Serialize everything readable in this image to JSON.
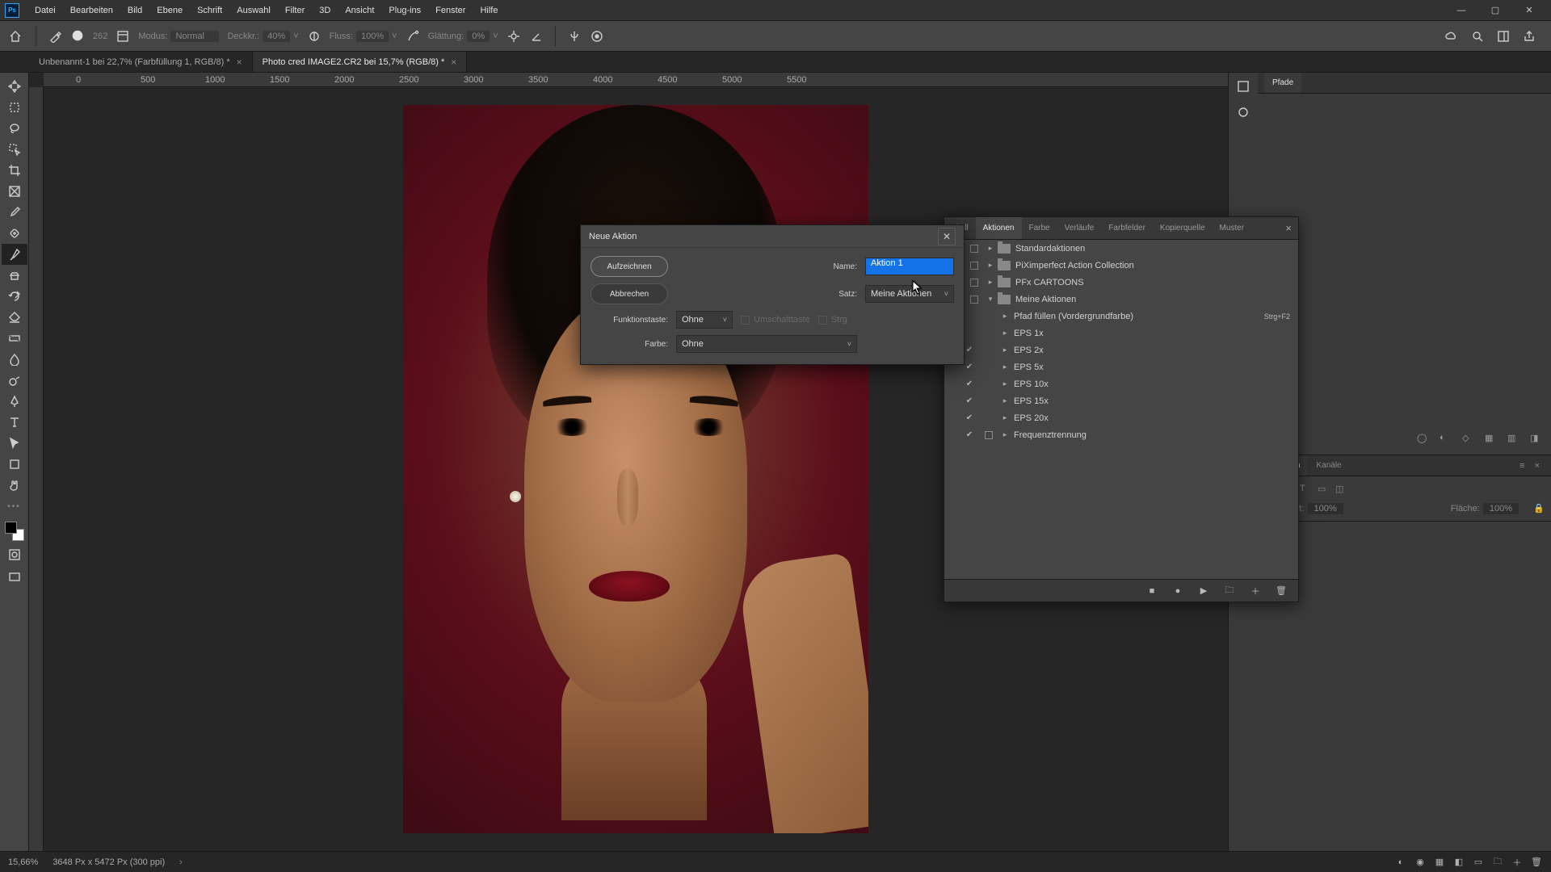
{
  "menubar": {
    "items": [
      "Datei",
      "Bearbeiten",
      "Bild",
      "Ebene",
      "Schrift",
      "Auswahl",
      "Filter",
      "3D",
      "Ansicht",
      "Plug-ins",
      "Fenster",
      "Hilfe"
    ]
  },
  "optbar": {
    "brush_size": "262",
    "mode_label": "Modus:",
    "mode_value": "Normal",
    "opacity_label": "Deckkr.:",
    "opacity_value": "40%",
    "flow_label": "Fluss:",
    "flow_value": "100%",
    "smoothing_label": "Glättung:",
    "smoothing_value": "0%"
  },
  "tabs": [
    {
      "label": "Unbenannt-1 bei 22,7% (Farbfüllung 1, RGB/8) *"
    },
    {
      "label": "Photo cred IMAGE2.CR2 bei 15,7% (RGB/8) *"
    }
  ],
  "ruler_marks": [
    "0",
    "500",
    "1000",
    "1500",
    "2000",
    "2500",
    "3000",
    "3500",
    "4000",
    "4500",
    "5000",
    "5500"
  ],
  "dialog": {
    "title": "Neue Aktion",
    "name_label": "Name:",
    "name_value": "Aktion 1",
    "set_label": "Satz:",
    "set_value": "Meine Aktionen",
    "fkey_label": "Funktionstaste:",
    "fkey_value": "Ohne",
    "shift_label": "Umschalttaste",
    "ctrl_label": "Strg",
    "color_label": "Farbe:",
    "color_value": "Ohne",
    "record_btn": "Aufzeichnen",
    "cancel_btn": "Abbrechen"
  },
  "actions_panel": {
    "tabs": [
      "okoll",
      "Aktionen",
      "Farbe",
      "Verläufe",
      "Farbfelder",
      "Kopierquelle",
      "Muster"
    ],
    "active": 1,
    "sets": [
      {
        "name": "Standardaktionen",
        "check": true,
        "dlg": true,
        "expanded": false
      },
      {
        "name": "PiXimperfect Action Collection",
        "check": true,
        "dlg": true,
        "expanded": false
      },
      {
        "name": "PFx CARTOONS",
        "check": true,
        "dlg": true,
        "expanded": false
      },
      {
        "name": "Meine Aktionen",
        "check": true,
        "dlg": true,
        "expanded": true,
        "children": [
          {
            "name": "Pfad füllen (Vordergrundfarbe)",
            "shortcut": "Strg+F2",
            "check": false,
            "dlg": false
          },
          {
            "name": "EPS 1x",
            "check": false,
            "dlg": false
          },
          {
            "name": "EPS 2x",
            "check": true,
            "dlg": false
          },
          {
            "name": "EPS 5x",
            "check": true,
            "dlg": false
          },
          {
            "name": "EPS 10x",
            "check": true,
            "dlg": false
          },
          {
            "name": "EPS 15x",
            "check": true,
            "dlg": false
          },
          {
            "name": "EPS 20x",
            "check": true,
            "dlg": false
          },
          {
            "name": "Frequenztrennung",
            "check": true,
            "dlg": true
          }
        ]
      }
    ]
  },
  "right_panels": {
    "top_tab": "Pfade",
    "layers_tabs": [
      "Ebenen",
      "Kanäle"
    ],
    "opacity_label": "Deckkraft:",
    "opacity_value": "100%",
    "fill_label": "Fläche:",
    "fill_value": "100%"
  },
  "statusbar": {
    "zoom": "15,66%",
    "doc": "3648 Px x 5472 Px (300 ppi)"
  }
}
